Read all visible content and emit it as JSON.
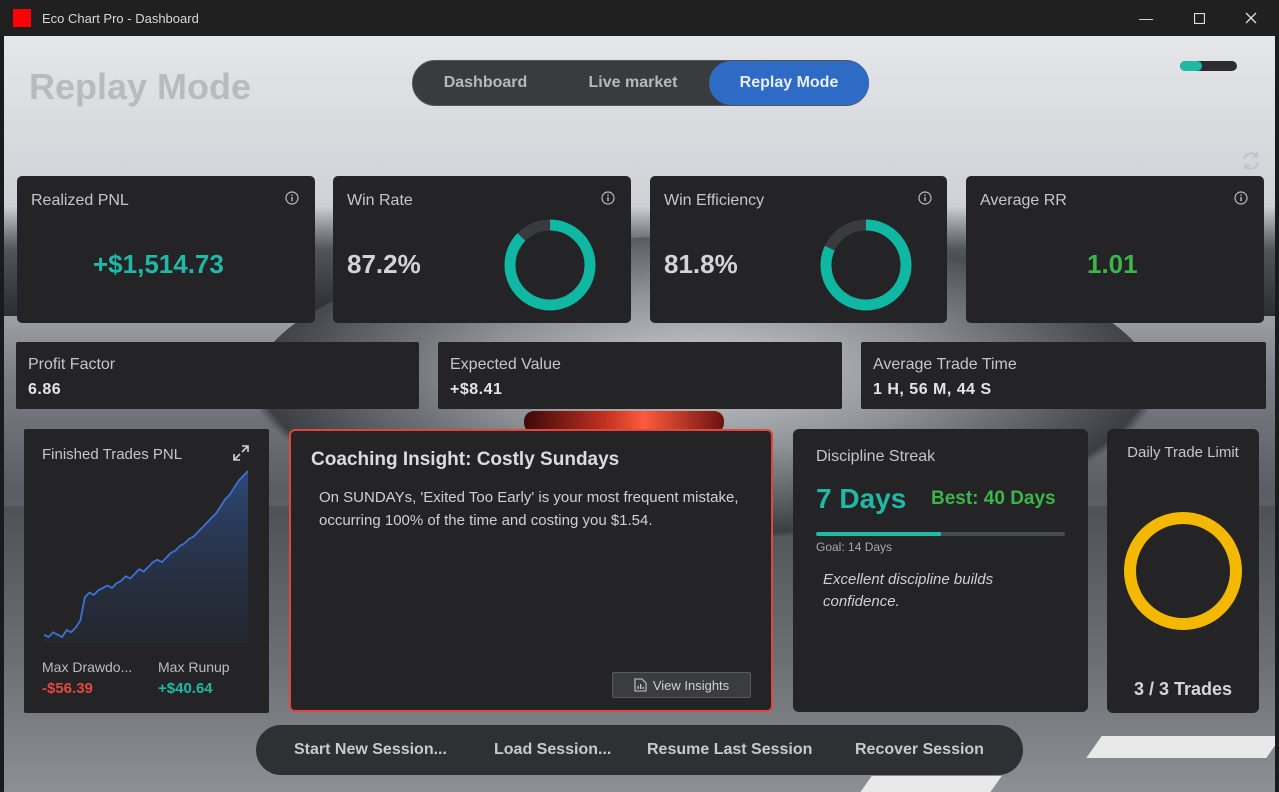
{
  "window": {
    "title": "Eco Chart Pro - Dashboard",
    "min_icon": "minimize-icon",
    "max_icon": "maximize-icon",
    "close_icon": "close-icon"
  },
  "header": {
    "title": "Replay Mode",
    "tabs": [
      "Dashboard",
      "Live market",
      "Replay Mode"
    ],
    "active_tab": "Replay Mode",
    "toggle_state": "on"
  },
  "colors": {
    "accent_teal": "#1fb9a5",
    "positive_green": "#3cb54a",
    "negative_red": "#e04a3f",
    "active_tab_blue": "#2e6bc4",
    "limit_yellow": "#f5b800",
    "coaching_border": "#e0463c"
  },
  "stats": {
    "realized_pnl": {
      "label": "Realized PNL",
      "value": "+$1,514.73"
    },
    "win_rate": {
      "label": "Win Rate",
      "value": "87.2%",
      "ring_fraction": 0.872
    },
    "win_efficiency": {
      "label": "Win Efficiency",
      "value": "81.8%",
      "ring_fraction": 0.818
    },
    "average_rr": {
      "label": "Average RR",
      "value": "1.01"
    }
  },
  "metrics": {
    "profit_factor": {
      "label": "Profit Factor",
      "value": "6.86"
    },
    "expected_value": {
      "label": "Expected Value",
      "value": "+$8.41"
    },
    "avg_trade_time": {
      "label": "Average Trade Time",
      "value": "1 H, 56 M, 44 S"
    }
  },
  "pnl_chart": {
    "title": "Finished Trades PNL",
    "max_drawdown_label": "Max Drawdo...",
    "max_drawdown_value": "-$56.39",
    "max_runup_label": "Max Runup",
    "max_runup_value": "+$40.64"
  },
  "chart_data": {
    "type": "area",
    "y": [
      2,
      1,
      3,
      2,
      1,
      4,
      3,
      5,
      8,
      18,
      20,
      19,
      21,
      22,
      23,
      22,
      24,
      25,
      27,
      26,
      28,
      30,
      29,
      31,
      33,
      34,
      33,
      35,
      37,
      38,
      40,
      41,
      43,
      44,
      46,
      48,
      50,
      52,
      54,
      57,
      60,
      62,
      65,
      68,
      70,
      72
    ]
  },
  "coaching": {
    "title": "Coaching Insight: Costly Sundays",
    "body": "On SUNDAYs, 'Exited Too Early' is your most frequent mistake, occurring 100% of the time and costing you $1.54.",
    "button": "View Insights"
  },
  "discipline": {
    "title": "Discipline Streak",
    "streak": "7 Days",
    "best": "Best: 40 Days",
    "goal": "Goal: 14 Days",
    "progress_fraction": 0.5,
    "message": "Excellent discipline builds confidence."
  },
  "daily_limit": {
    "title": "Daily Trade Limit",
    "value": "3 / 3 Trades"
  },
  "session": {
    "buttons": [
      "Start New Session...",
      "Load Session...",
      "Resume Last Session",
      "Recover Session"
    ]
  }
}
